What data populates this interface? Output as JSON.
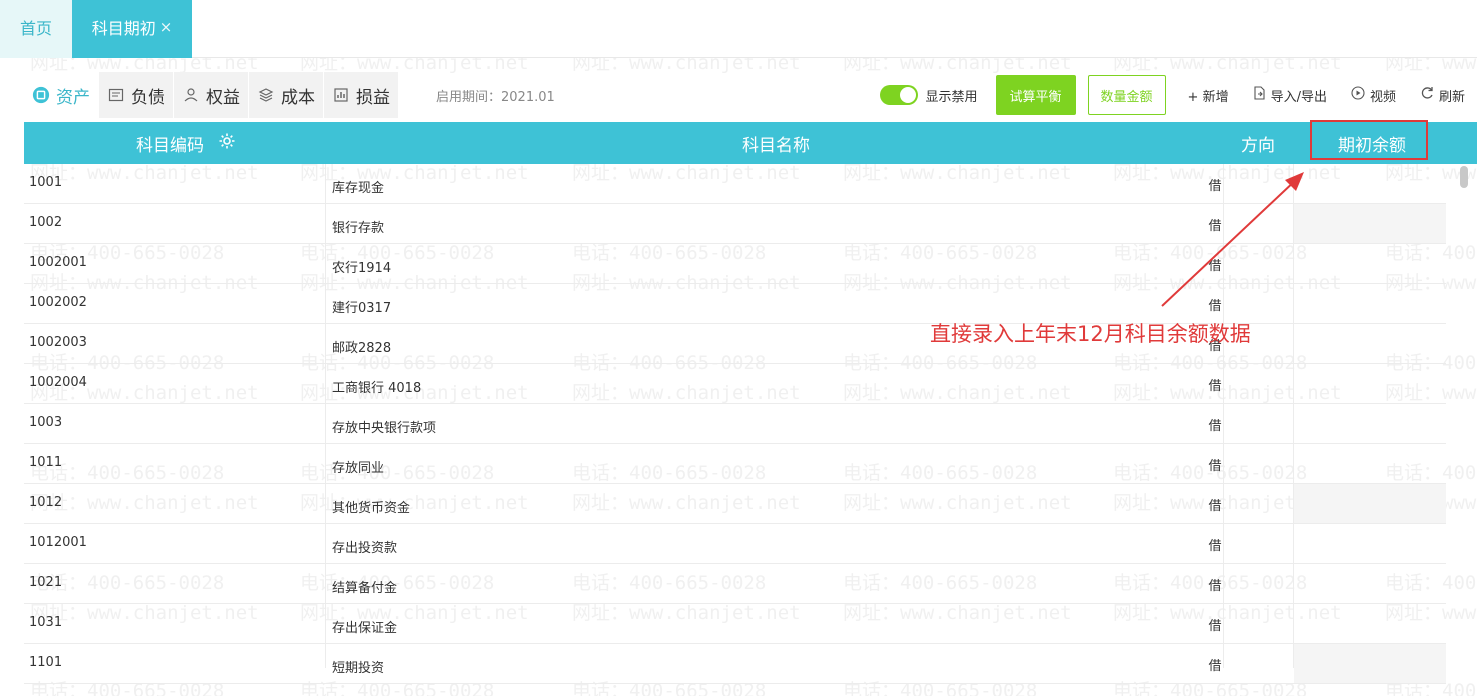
{
  "tabs": {
    "home": "首页",
    "active": "科目期初",
    "close": "×"
  },
  "categories": [
    {
      "label": "资产",
      "icon": "asset-icon",
      "active": true
    },
    {
      "label": "负债",
      "icon": "liability-icon",
      "active": false
    },
    {
      "label": "权益",
      "icon": "equity-icon",
      "active": false
    },
    {
      "label": "成本",
      "icon": "cost-icon",
      "active": false
    },
    {
      "label": "损益",
      "icon": "profit-loss-icon",
      "active": false
    }
  ],
  "period_label": "启用期间：2021.01",
  "toolbar": {
    "toggle_label": "显示禁用",
    "trial_balance": "试算平衡",
    "qty_amount": "数量金额",
    "add": "+ 新增",
    "import_export": "导入/导出",
    "video": "视频",
    "refresh": "刷新"
  },
  "table": {
    "headers": {
      "code": "科目编码",
      "name": "科目名称",
      "direction": "方向",
      "opening_balance": "期初余额"
    },
    "rows": [
      {
        "code": "1001",
        "name": "库存现金",
        "direction": "借"
      },
      {
        "code": "1002",
        "name": "银行存款",
        "direction": "借"
      },
      {
        "code": "1002001",
        "name": "农行1914",
        "direction": "借"
      },
      {
        "code": "1002002",
        "name": "建行0317",
        "direction": "借"
      },
      {
        "code": "1002003",
        "name": "邮政2828",
        "direction": "借"
      },
      {
        "code": "1002004",
        "name": "工商银行 4018",
        "direction": "借"
      },
      {
        "code": "1003",
        "name": "存放中央银行款项",
        "direction": "借"
      },
      {
        "code": "1011",
        "name": "存放同业",
        "direction": "借"
      },
      {
        "code": "1012",
        "name": "其他货币资金",
        "direction": "借"
      },
      {
        "code": "1012001",
        "name": "存出投资款",
        "direction": "借"
      },
      {
        "code": "1021",
        "name": "结算备付金",
        "direction": "借"
      },
      {
        "code": "1031",
        "name": "存出保证金",
        "direction": "借"
      },
      {
        "code": "1101",
        "name": "短期投资",
        "direction": "借"
      }
    ]
  },
  "annotation": "直接录入上年末12月科目余额数据",
  "watermark": {
    "phone": "电话：400-665-0028",
    "site": "网址：www.chanjet.net"
  },
  "colors": {
    "accent": "#3ec2d6",
    "green": "#7ed321",
    "annotation": "#e03a3a"
  }
}
